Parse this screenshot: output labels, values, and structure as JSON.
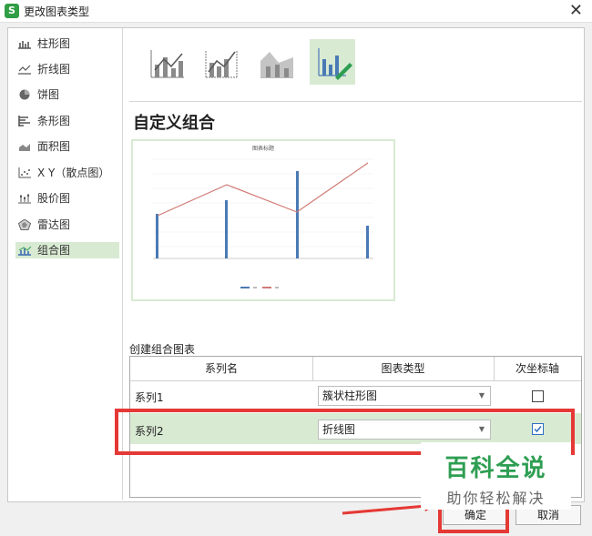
{
  "window": {
    "title": "更改图表类型",
    "app_icon": "S"
  },
  "sidebar": {
    "items": [
      {
        "label": "柱形图",
        "icon": "column-chart-icon"
      },
      {
        "label": "折线图",
        "icon": "line-chart-icon"
      },
      {
        "label": "饼图",
        "icon": "pie-chart-icon"
      },
      {
        "label": "条形图",
        "icon": "bar-chart-icon"
      },
      {
        "label": "面积图",
        "icon": "area-chart-icon"
      },
      {
        "label": "X Y（散点图）",
        "icon": "scatter-chart-icon"
      },
      {
        "label": "股价图",
        "icon": "stock-chart-icon"
      },
      {
        "label": "雷达图",
        "icon": "radar-chart-icon"
      },
      {
        "label": "组合图",
        "icon": "combo-chart-icon"
      }
    ],
    "selected": "组合图"
  },
  "main": {
    "heading": "自定义组合",
    "preview_title": "图表标题",
    "combo_label": "创建组合图表",
    "table": {
      "headers": [
        "系列名",
        "图表类型",
        "次坐标轴"
      ],
      "rows": [
        {
          "name": "系列1",
          "type": "簇状柱形图",
          "secondary": false
        },
        {
          "name": "系列2",
          "type": "折线图",
          "secondary": true
        }
      ]
    }
  },
  "footer": {
    "ok": "确定",
    "cancel": "取消"
  },
  "watermark": {
    "title": "百科全说",
    "subtitle": "助你轻松解决"
  },
  "colors": {
    "accent": "#d9ead3",
    "highlight": "#e53935",
    "bar": "#4a7ab5",
    "line": "#d07a74",
    "watermark": "#2e9e52"
  }
}
